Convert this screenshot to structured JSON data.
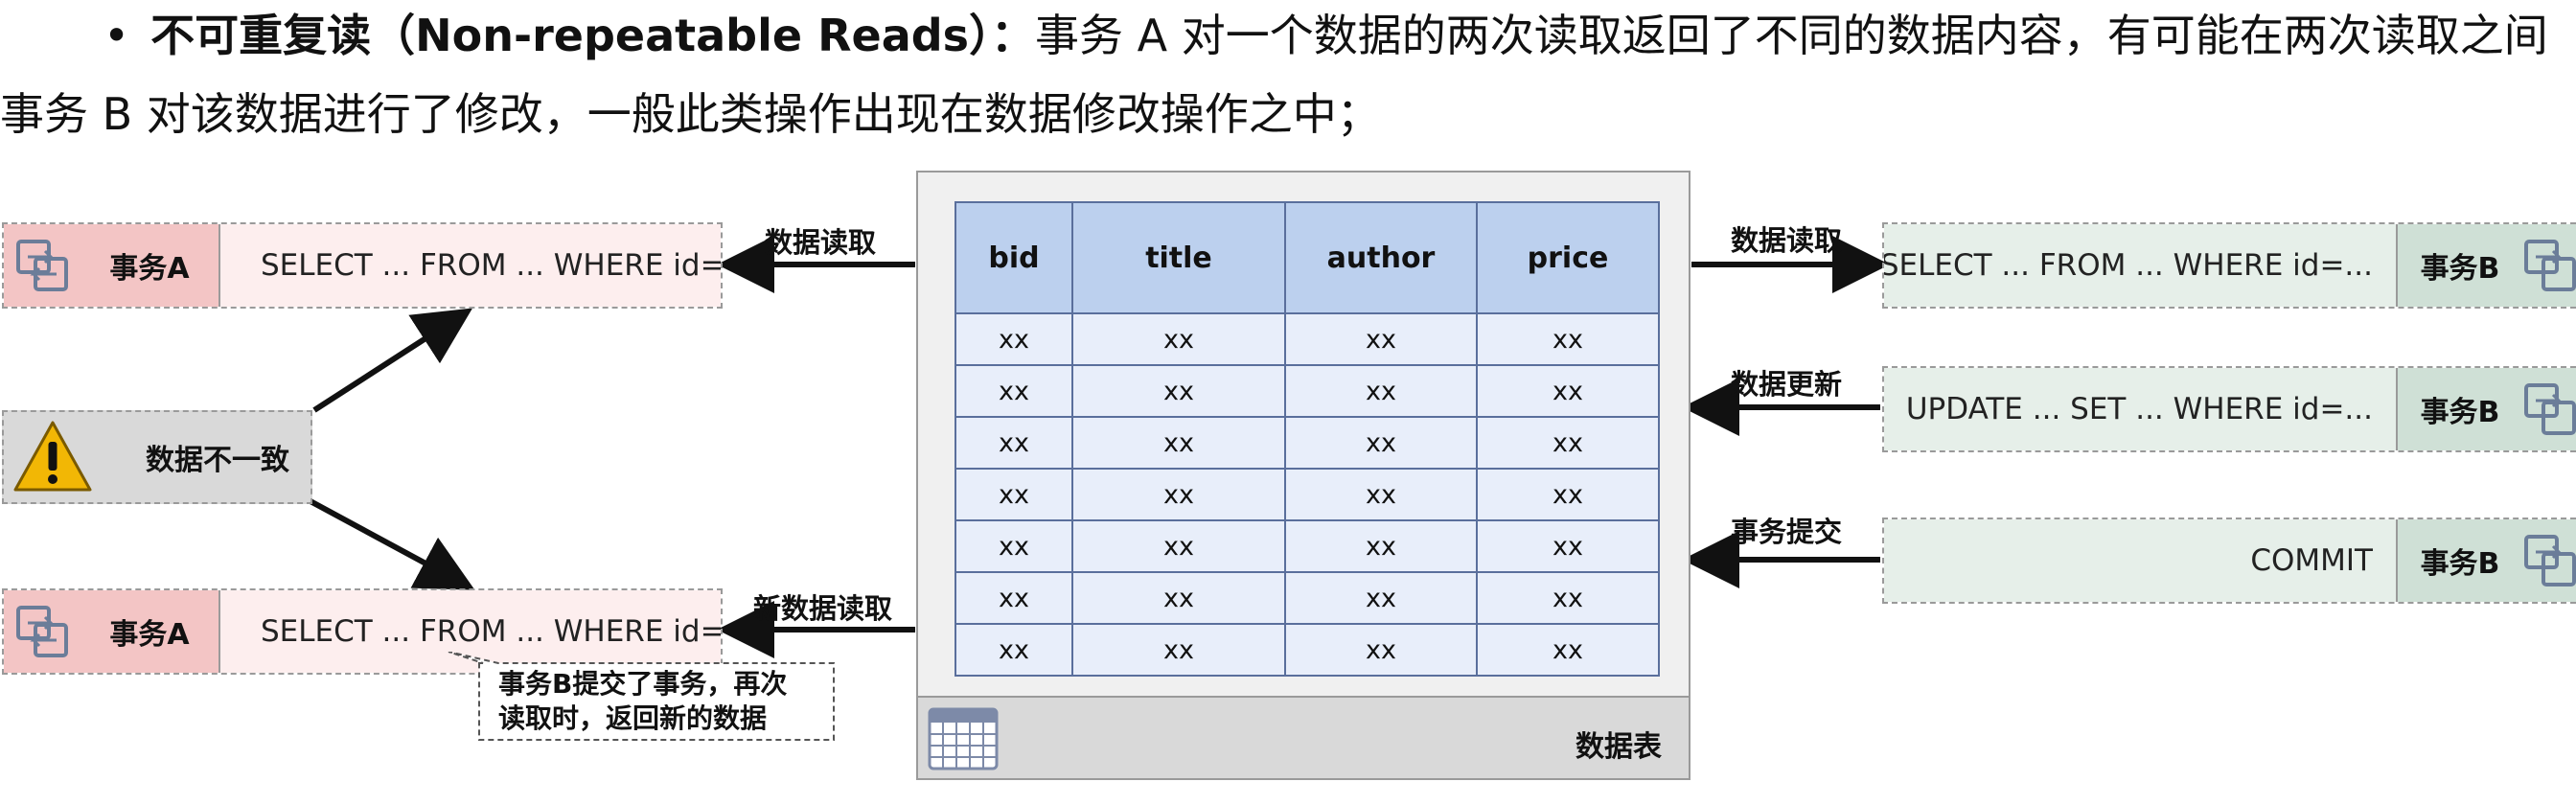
{
  "paragraph": {
    "bullet": "•",
    "term": "不可重复读（Non-repeatable Reads）：",
    "line1_rest": "事务 A 对一个数据的两次读取返回了不同的数据内容，有可能在两次读取之间",
    "line2": "事务 B 对该数据进行了修改，一般此类操作出现在数据修改操作之中；"
  },
  "left": {
    "tx_top": {
      "label": "事务A",
      "sql": "SELECT ... FROM ... WHERE id=..."
    },
    "tx_bottom": {
      "label": "事务A",
      "sql": "SELECT ... FROM ... WHERE id=..."
    },
    "warning": {
      "label": "数据不一致",
      "icon": "warning-icon"
    },
    "arrow_top_label": "数据读取",
    "arrow_bottom_label": "新数据读取",
    "callout_line1": "事务B提交了事务，再次",
    "callout_line2": "读取时，返回新的数据"
  },
  "table": {
    "columns": [
      "bid",
      "title",
      "author",
      "price"
    ],
    "rows": [
      [
        "xx",
        "xx",
        "xx",
        "xx"
      ],
      [
        "xx",
        "xx",
        "xx",
        "xx"
      ],
      [
        "xx",
        "xx",
        "xx",
        "xx"
      ],
      [
        "xx",
        "xx",
        "xx",
        "xx"
      ],
      [
        "xx",
        "xx",
        "xx",
        "xx"
      ],
      [
        "xx",
        "xx",
        "xx",
        "xx"
      ],
      [
        "xx",
        "xx",
        "xx",
        "xx"
      ]
    ],
    "footer_label": "数据表",
    "icon": "table-grid-icon"
  },
  "right": {
    "tx1": {
      "label": "事务B",
      "sql": "SELECT ... FROM ... WHERE id=...",
      "arrow_label": "数据读取"
    },
    "tx2": {
      "label": "事务B",
      "sql": "UPDATE ... SET ... WHERE id=...",
      "arrow_label": "数据更新"
    },
    "tx3": {
      "label": "事务B",
      "sql": "COMMIT",
      "arrow_label": "事务提交"
    }
  },
  "colors": {
    "tx_a_accent": "#f3c5c5",
    "tx_a_body": "#fdeeee",
    "tx_b_accent": "#cfe0d6",
    "tx_b_body": "#e6efe9",
    "table_header": "#bcd0ee",
    "table_cell": "#e8eefa",
    "warning": "#f2b705"
  }
}
